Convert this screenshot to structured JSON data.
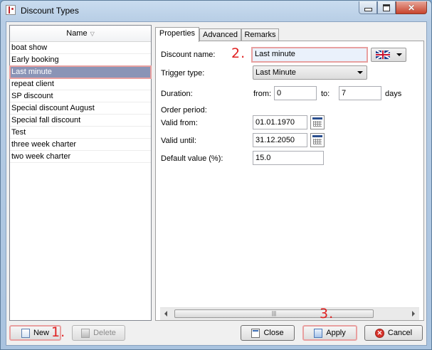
{
  "window": {
    "title": "Discount Types"
  },
  "list": {
    "header": "Name",
    "items": [
      "boat show",
      "Early booking",
      "Last minute",
      "repeat client",
      "SP discount",
      "Special discount August",
      "Special fall discount",
      "Test",
      "three week charter",
      "two week charter"
    ],
    "selected": "Last minute"
  },
  "tabs": [
    "Properties",
    "Advanced",
    "Remarks"
  ],
  "form": {
    "discount_name_label": "Discount name:",
    "discount_name_value": "Last minute",
    "trigger_type_label": "Trigger type:",
    "trigger_type_value": "Last Minute",
    "duration_label": "Duration:",
    "from_label": "from:",
    "from_value": "0",
    "to_label": "to:",
    "to_value": "7",
    "duration_unit": "days",
    "order_period_label": "Order period:",
    "valid_from_label": "Valid from:",
    "valid_from_value": "01.01.1970",
    "valid_until_label": "Valid until:",
    "valid_until_value": "31.12.2050",
    "default_value_label": "Default value (%):",
    "default_value_value": "15.0"
  },
  "buttons": {
    "new": "New",
    "delete": "Delete",
    "close": "Close",
    "apply": "Apply",
    "cancel": "Cancel"
  },
  "annotations": {
    "a1": "1.",
    "a2": "2.",
    "a3": "3."
  },
  "icons": [
    "app-icon",
    "minimize-icon",
    "maximize-icon",
    "close-window-icon",
    "sort-icon",
    "uk-flag-icon",
    "calendar-icon",
    "new-icon",
    "delete-icon",
    "close-icon",
    "apply-icon",
    "cancel-icon"
  ],
  "colors": {
    "annotation": "#e02020",
    "highlight_border": "#e8a0a0",
    "selection": "#8a94b6"
  }
}
